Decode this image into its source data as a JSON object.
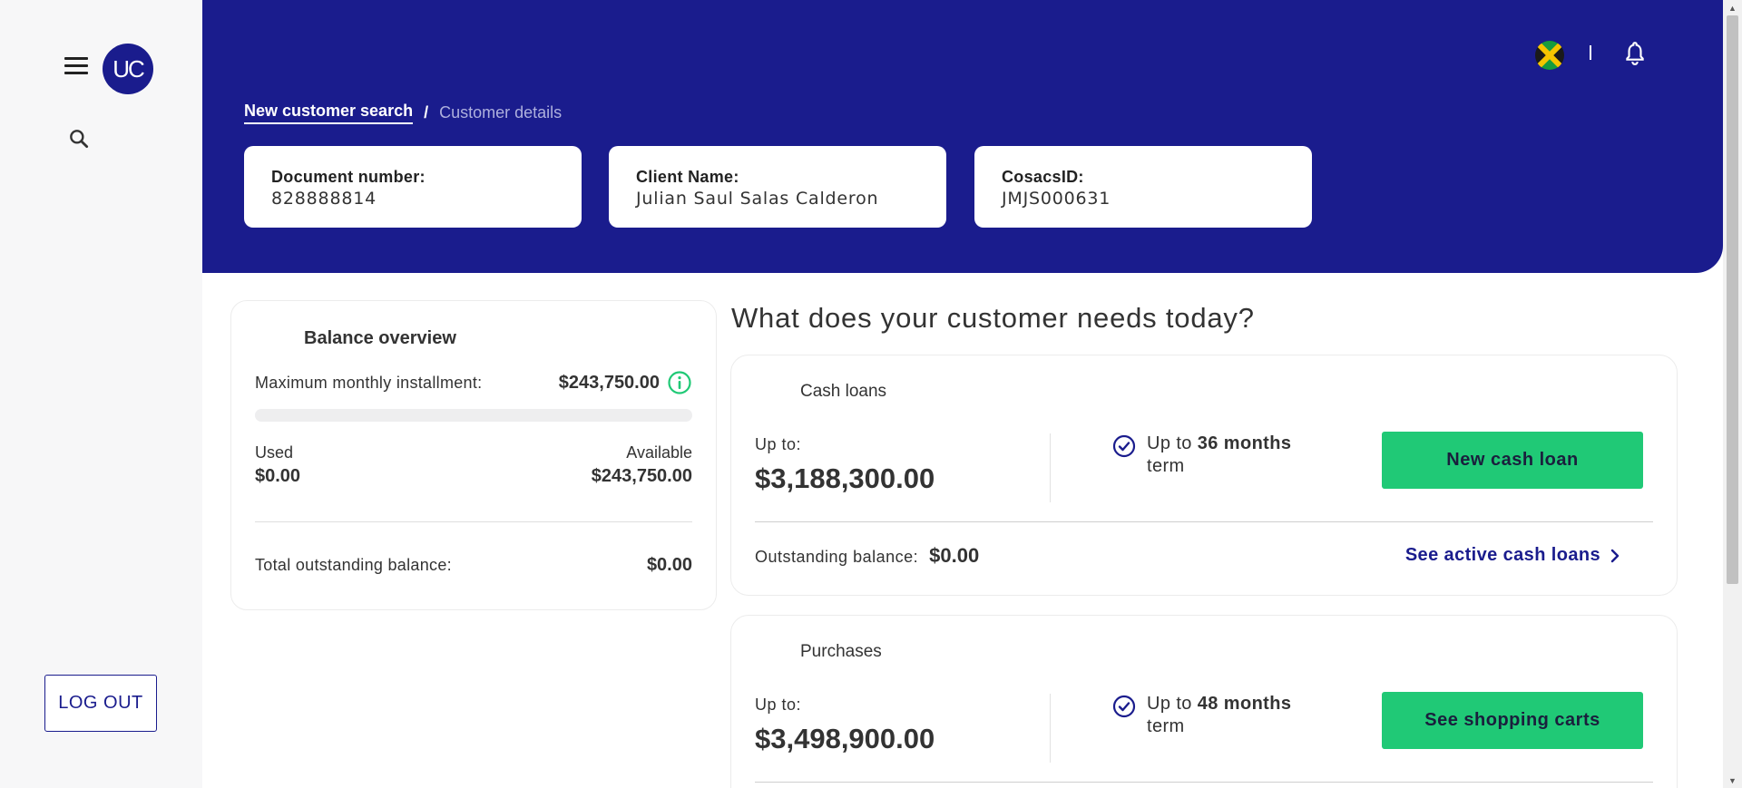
{
  "sidebar": {
    "logo_text": "UC",
    "logout_label": "LOG OUT"
  },
  "header": {
    "breadcrumb": {
      "link": "New customer search",
      "separator": "/",
      "current": "Customer details"
    },
    "separator_text": "I",
    "cards": [
      {
        "label": "Document number:",
        "value": "828888814"
      },
      {
        "label": "Client Name:",
        "value": "Julian Saul Salas Calderon"
      },
      {
        "label": "CosacsID:",
        "value": "JMJS000631"
      }
    ]
  },
  "balance": {
    "title": "Balance overview",
    "max_label": "Maximum monthly installment:",
    "max_value": "$243,750.00",
    "used_fraction": 0,
    "used_label": "Used",
    "used_value": "$0.00",
    "available_label": "Available",
    "available_value": "$243,750.00",
    "total_label": "Total outstanding balance:",
    "total_value": "$0.00"
  },
  "main": {
    "question": "What does your customer needs today?",
    "products": [
      {
        "title": "Cash loans",
        "upto_label": "Up to:",
        "upto_value": "$3,188,300.00",
        "term_prefix": "Up to ",
        "term_bold": "36 months",
        "term_suffix": "term",
        "button": "New cash loan",
        "outstanding_label": "Outstanding balance:",
        "outstanding_value": "$0.00",
        "link": "See active cash loans"
      },
      {
        "title": "Purchases",
        "upto_label": "Up to:",
        "upto_value": "$3,498,900.00",
        "term_prefix": "Up to ",
        "term_bold": "48 months",
        "term_suffix": "term",
        "button": "See shopping carts"
      }
    ]
  },
  "colors": {
    "brand_navy": "#1a1c8d",
    "accent_green": "#20c976",
    "sidebar_bg": "#f7f7f8"
  },
  "icons": [
    "menu-icon",
    "search-icon",
    "jamaica-flag-icon",
    "bell-icon",
    "info-icon",
    "check-circle-icon",
    "chevron-right-icon"
  ]
}
